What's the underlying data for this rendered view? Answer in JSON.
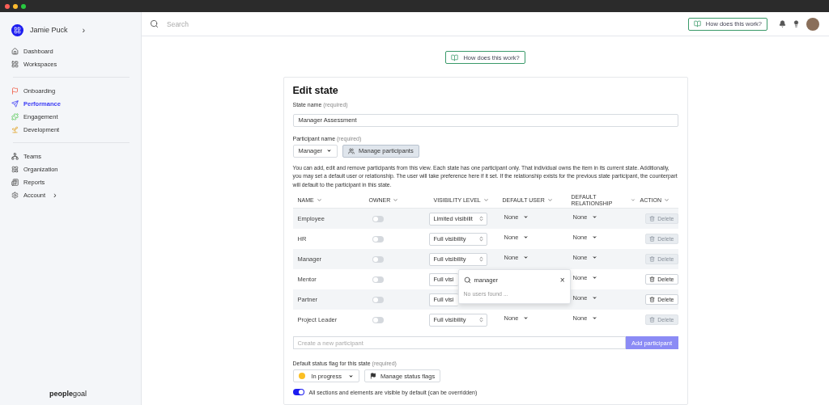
{
  "sidebar": {
    "user": {
      "name": "Jamie Puck",
      "chevron": "›"
    },
    "groups": [
      [
        {
          "label": "Dashboard",
          "selected": false
        },
        {
          "label": "Workspaces",
          "selected": false
        }
      ],
      [
        {
          "label": "Onboarding",
          "selected": false
        },
        {
          "label": "Performance",
          "selected": true
        },
        {
          "label": "Engagement",
          "selected": false
        },
        {
          "label": "Development",
          "selected": false
        }
      ],
      [
        {
          "label": "Teams",
          "selected": false
        },
        {
          "label": "Organization",
          "selected": false
        },
        {
          "label": "Reports",
          "selected": false
        },
        {
          "label": "Account",
          "selected": false,
          "chevron": "›"
        }
      ]
    ],
    "logo": "**people**goal"
  },
  "topbar": {
    "search": {
      "placeholder": "Search"
    },
    "help_button": "How does this work?"
  },
  "help_button": "How does this work?",
  "form": {
    "title": "Edit state",
    "state_name": {
      "label": "State name",
      "hint": "(required)",
      "value": "Manager Assessment"
    },
    "participant": {
      "label": "Participant name",
      "hint": "(required)",
      "value": "Manager",
      "manage_button": "Manage participants"
    },
    "description": "You can add, edit and remove participants from this view. Each state has one participant only. That individual owns the item in its current state. Additionally, you may set a default user or relationship. The user will take preference here if it set. If the relationship exists for the previous state participant, the counterpart will default to the participant in this state.",
    "table": {
      "columns": [
        "NAME",
        "OWNER",
        "VISIBILITY LEVEL",
        "DEFAULT USER",
        "DEFAULT RELATIONSHIP",
        "ACTION"
      ],
      "rows": [
        {
          "name": "Employee",
          "owner": false,
          "visibility": "Limited visibilit",
          "default_user": "None",
          "default_relationship": "None",
          "action": "Delete",
          "disabled": true
        },
        {
          "name": "HR",
          "owner": false,
          "visibility": "Full visibility",
          "default_user": "None",
          "default_relationship": "None",
          "action": "Delete",
          "disabled": true
        },
        {
          "name": "Manager",
          "owner": false,
          "visibility": "Full visibility",
          "default_user": "None",
          "default_relationship": "None",
          "action": "Delete",
          "disabled": true
        },
        {
          "name": "Mentor",
          "owner": false,
          "visibility": "Full visi",
          "default_relationship": "None",
          "action": "Delete",
          "disabled": false
        },
        {
          "name": "Partner",
          "owner": false,
          "visibility": "Full visi",
          "default_relationship": "None",
          "action": "Delete",
          "disabled": false
        },
        {
          "name": "Project Leader",
          "owner": false,
          "visibility": "Full visibility",
          "default_user": "None",
          "default_relationship": "None",
          "action": "Delete",
          "disabled": true
        }
      ],
      "popover": {
        "search_value": "manager",
        "clear": "×",
        "empty": "No users found ..."
      }
    },
    "new_participant": {
      "placeholder": "Create a new participant",
      "button": "Add participant"
    },
    "status_flag": {
      "label": "Default status flag for this state",
      "hint": "(required)",
      "value": "In progress",
      "color": "#fbbf24",
      "manage_button": "Manage status flags"
    },
    "visibility_toggle": {
      "on": true,
      "label": "All sections and elements are visible by default (can be overridden)"
    }
  }
}
